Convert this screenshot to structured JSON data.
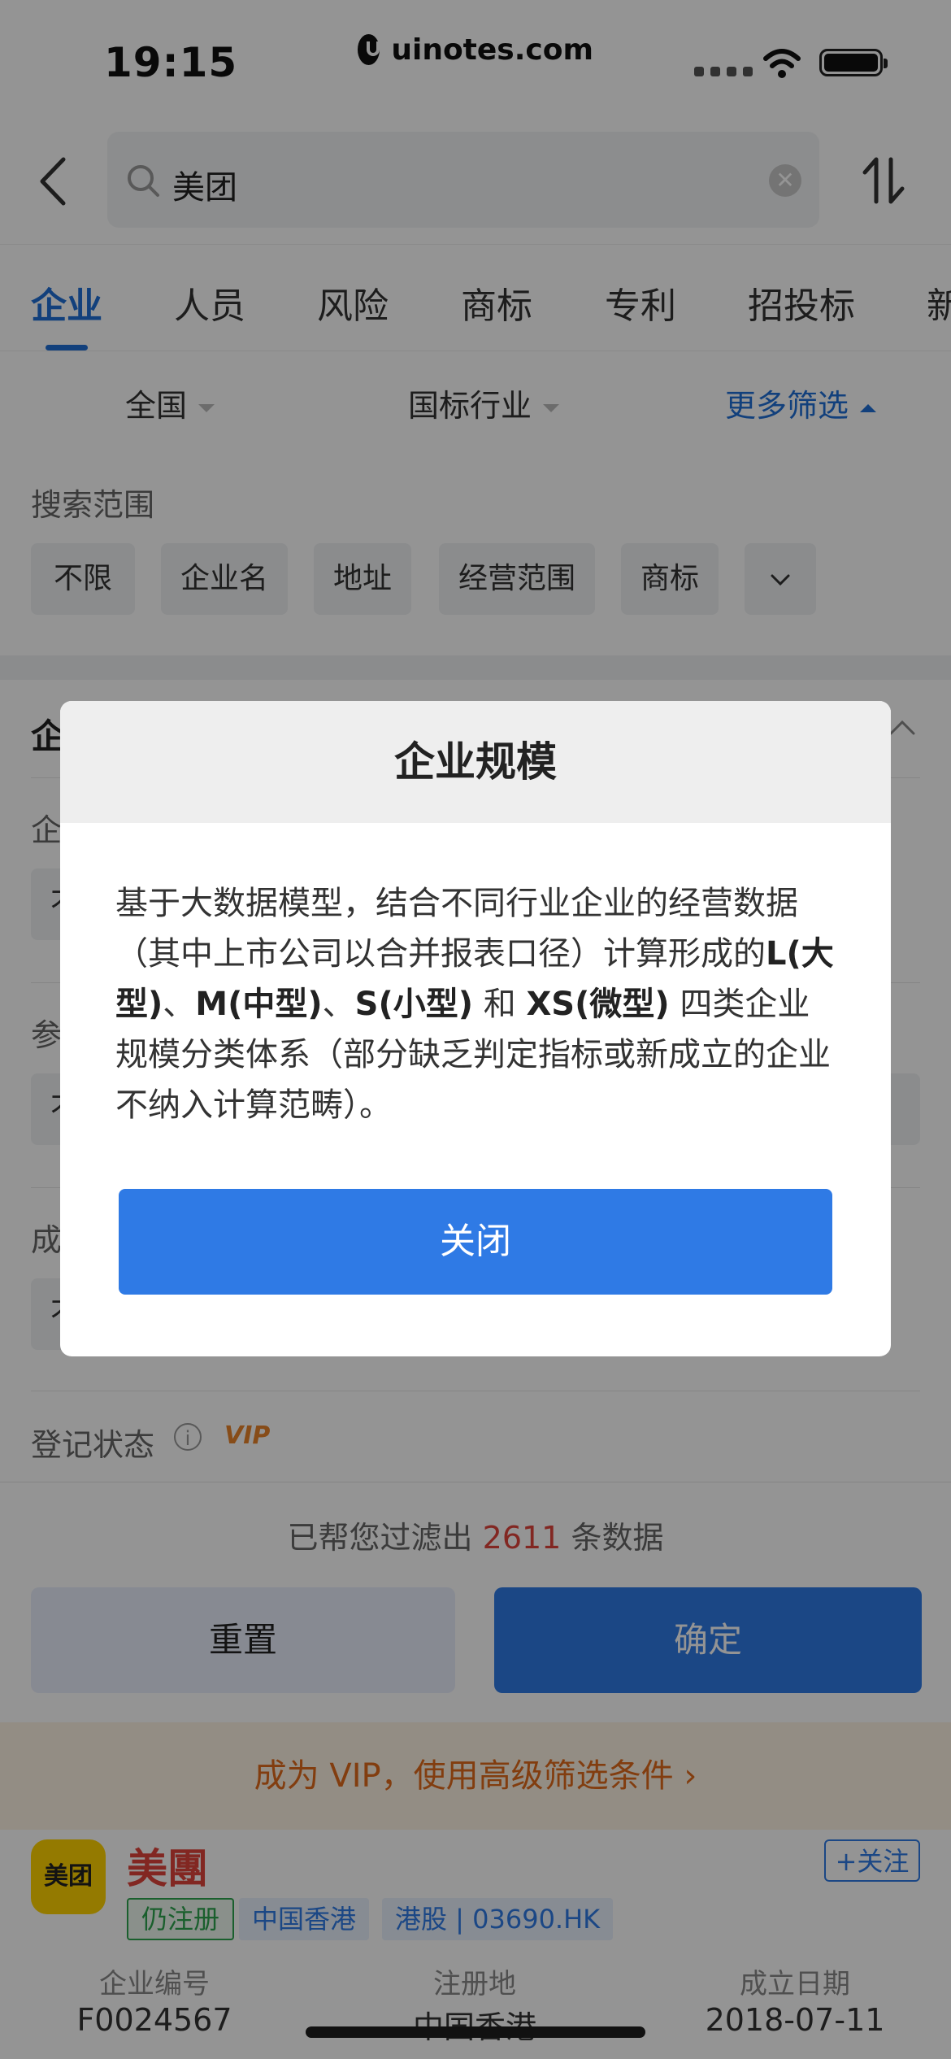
{
  "status_bar": {
    "time": "19:15",
    "watermark": "uinotes.com"
  },
  "search": {
    "query": "美团"
  },
  "tabs": [
    "企业",
    "人员",
    "风险",
    "商标",
    "专利",
    "招投标",
    "新"
  ],
  "filters": {
    "region": "全国",
    "industry": "国标行业",
    "more": "更多筛选"
  },
  "panel": {
    "search_scope_label": "搜索范围",
    "scope_chips": [
      "不限",
      "企业名",
      "地址",
      "经营范围",
      "商标"
    ],
    "partial_labels": [
      "企",
      "企",
      "参",
      "成"
    ],
    "partial_chip": "不",
    "register_status_label": "登记状态",
    "vip_badge": "VIP"
  },
  "result": {
    "prefix": "已帮您过滤出",
    "count": "2611",
    "suffix": "条数据"
  },
  "buttons": {
    "reset": "重置",
    "confirm": "确定"
  },
  "vip_banner": "成为 VIP，使用高级筛选条件 ›",
  "company": {
    "logo_text": "美团",
    "name": "美團",
    "follow": "+关注",
    "tags": [
      "仍注册",
      "中国香港",
      "港股 | 03690.HK"
    ],
    "meta": [
      {
        "label": "企业编号",
        "value": "F0024567"
      },
      {
        "label": "注册地",
        "value": "中国香港"
      },
      {
        "label": "成立日期",
        "value": "2018-07-11"
      }
    ]
  },
  "modal": {
    "title": "企业规模",
    "body_parts": [
      "基于大数据模型，结合不同行业企业的经营数据（其中上市公司以合并报表口径）计算形成的",
      "L(大型)",
      "、",
      "M(中型)",
      "、",
      "S(小型)",
      "和",
      "XS(微型)",
      "四类企业规模分类体系（部分缺乏判定指标或新成立的企业不纳入计算范畴）。"
    ],
    "close": "关闭"
  },
  "colors": {
    "accent": "#2f7ae5",
    "danger": "#e0443b",
    "vip": "#e06a1a"
  }
}
